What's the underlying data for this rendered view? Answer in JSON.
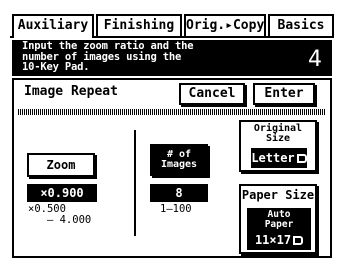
{
  "tabs": [
    {
      "label": "Auxiliary"
    },
    {
      "label": "Finishing"
    },
    {
      "label": "Orig.▸Copy"
    },
    {
      "label": "Basics"
    }
  ],
  "message": {
    "text": "Input the zoom ratio and the\nnumber of images using the\n10-Key Pad.",
    "step": "4"
  },
  "panel": {
    "title": "Image Repeat",
    "cancel_label": "Cancel",
    "enter_label": "Enter"
  },
  "zoom": {
    "button_label": "Zoom",
    "value": "×0.900",
    "range": "×0.500\n   – 4.000"
  },
  "images": {
    "button_label": "# of\nImages",
    "value": "8",
    "range": "1–100"
  },
  "original_size": {
    "title": "Original\nSize",
    "value": "Letter"
  },
  "paper_size": {
    "title": "Paper Size",
    "mode": "Auto\nPaper",
    "value": "11×17"
  },
  "icons": {
    "letter_orientation": "landscape-page-icon",
    "paper_orientation": "landscape-page-icon"
  },
  "colors": {
    "background": "#ffffff",
    "ink": "#000000",
    "highlight_text": "#ffffff"
  }
}
